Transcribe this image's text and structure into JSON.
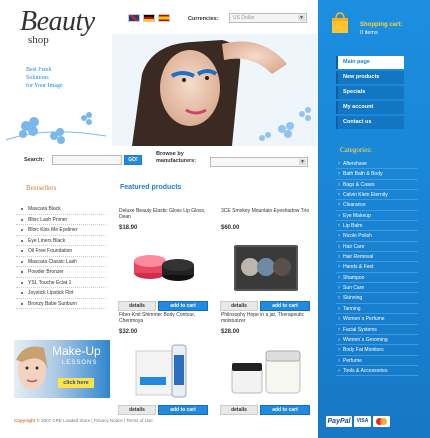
{
  "header": {
    "logo_big": "Beauty",
    "logo_small": "shop",
    "tagline": [
      "Best Fresh",
      "Solutions",
      "for Your Image"
    ],
    "flags": [
      "uk-flag-icon",
      "germany-flag-icon",
      "spain-flag-icon"
    ],
    "currency_label": "Currencies:",
    "currency_value": "US Dollar"
  },
  "cart": {
    "title": "Shopping cart:",
    "items": "0 items"
  },
  "nav": [
    {
      "label": "Main page",
      "active": true
    },
    {
      "label": "New products",
      "active": false
    },
    {
      "label": "Specials",
      "active": false
    },
    {
      "label": "My account",
      "active": false
    },
    {
      "label": "Contact us",
      "active": false
    }
  ],
  "categories_title": "Categories:",
  "categories": [
    "Aftershave",
    "Bath Bath & Body",
    "Bags & Cases",
    "Calvin Klein Eternity",
    "Clearance",
    "Eye Makeup",
    "Lip Balm",
    "Nicole Polish",
    "Hair Care",
    "Hair Removal",
    "Hands & Feet",
    "Shampoo",
    "Sun Care",
    "Skinning",
    "Tanning",
    "Women`s Perfume",
    "Facial Systems",
    "Women`s Grooming",
    "Body Fat Monitors",
    "Perfume",
    "Tools & Accessories"
  ],
  "search": {
    "label": "Search:",
    "go": "GO!",
    "browse_label_1": "Browse by",
    "browse_label_2": "manufacturers:"
  },
  "bestsellers_title": "Bestsellers",
  "bestsellers": [
    "Mascara Black",
    "Blinc Lash Primer",
    "Blinc Kiss Me Eyeliner",
    "Eye Liners Black",
    "Oil Free Foundation",
    "Mascara Classic Lash",
    "Powder Bronzer",
    "YSL Touche Eclat 1",
    "Joystick Lipstick Flirt",
    "Bronzy Babe Sunburn"
  ],
  "banner": {
    "title": "Make-Up",
    "subtitle": "LESSONS",
    "button": "click here"
  },
  "featured_title": "Featured products",
  "products": [
    {
      "name": "Deluxe Beauty Elastic Gloss Lip Gloss, Dean",
      "price": "$18.90"
    },
    {
      "name": "3CE Smokey Mountain Eyeshadow Trio",
      "price": "$60.00"
    },
    {
      "name": "Fiber-Knit Shimmer Body Contour, Cherimoya",
      "price": "$32.00"
    },
    {
      "name": "Philosophy Hope in a jar, Therapeutic moisturizer",
      "price": "$28.00"
    }
  ],
  "product_buttons": {
    "details": "details",
    "add": "add to cart"
  },
  "footer": {
    "copyright": "Copyright",
    "text": "© 2007 CRE Loaded Store",
    "privacy": "Privacy Notice",
    "terms": "Terms of Use"
  },
  "payments": [
    "PayPal",
    "VISA",
    "MasterCard"
  ],
  "colors": {
    "accent_blue": "#1f8ae0",
    "orange_heading": "#d47b2b",
    "yellow": "#ffe24a"
  }
}
